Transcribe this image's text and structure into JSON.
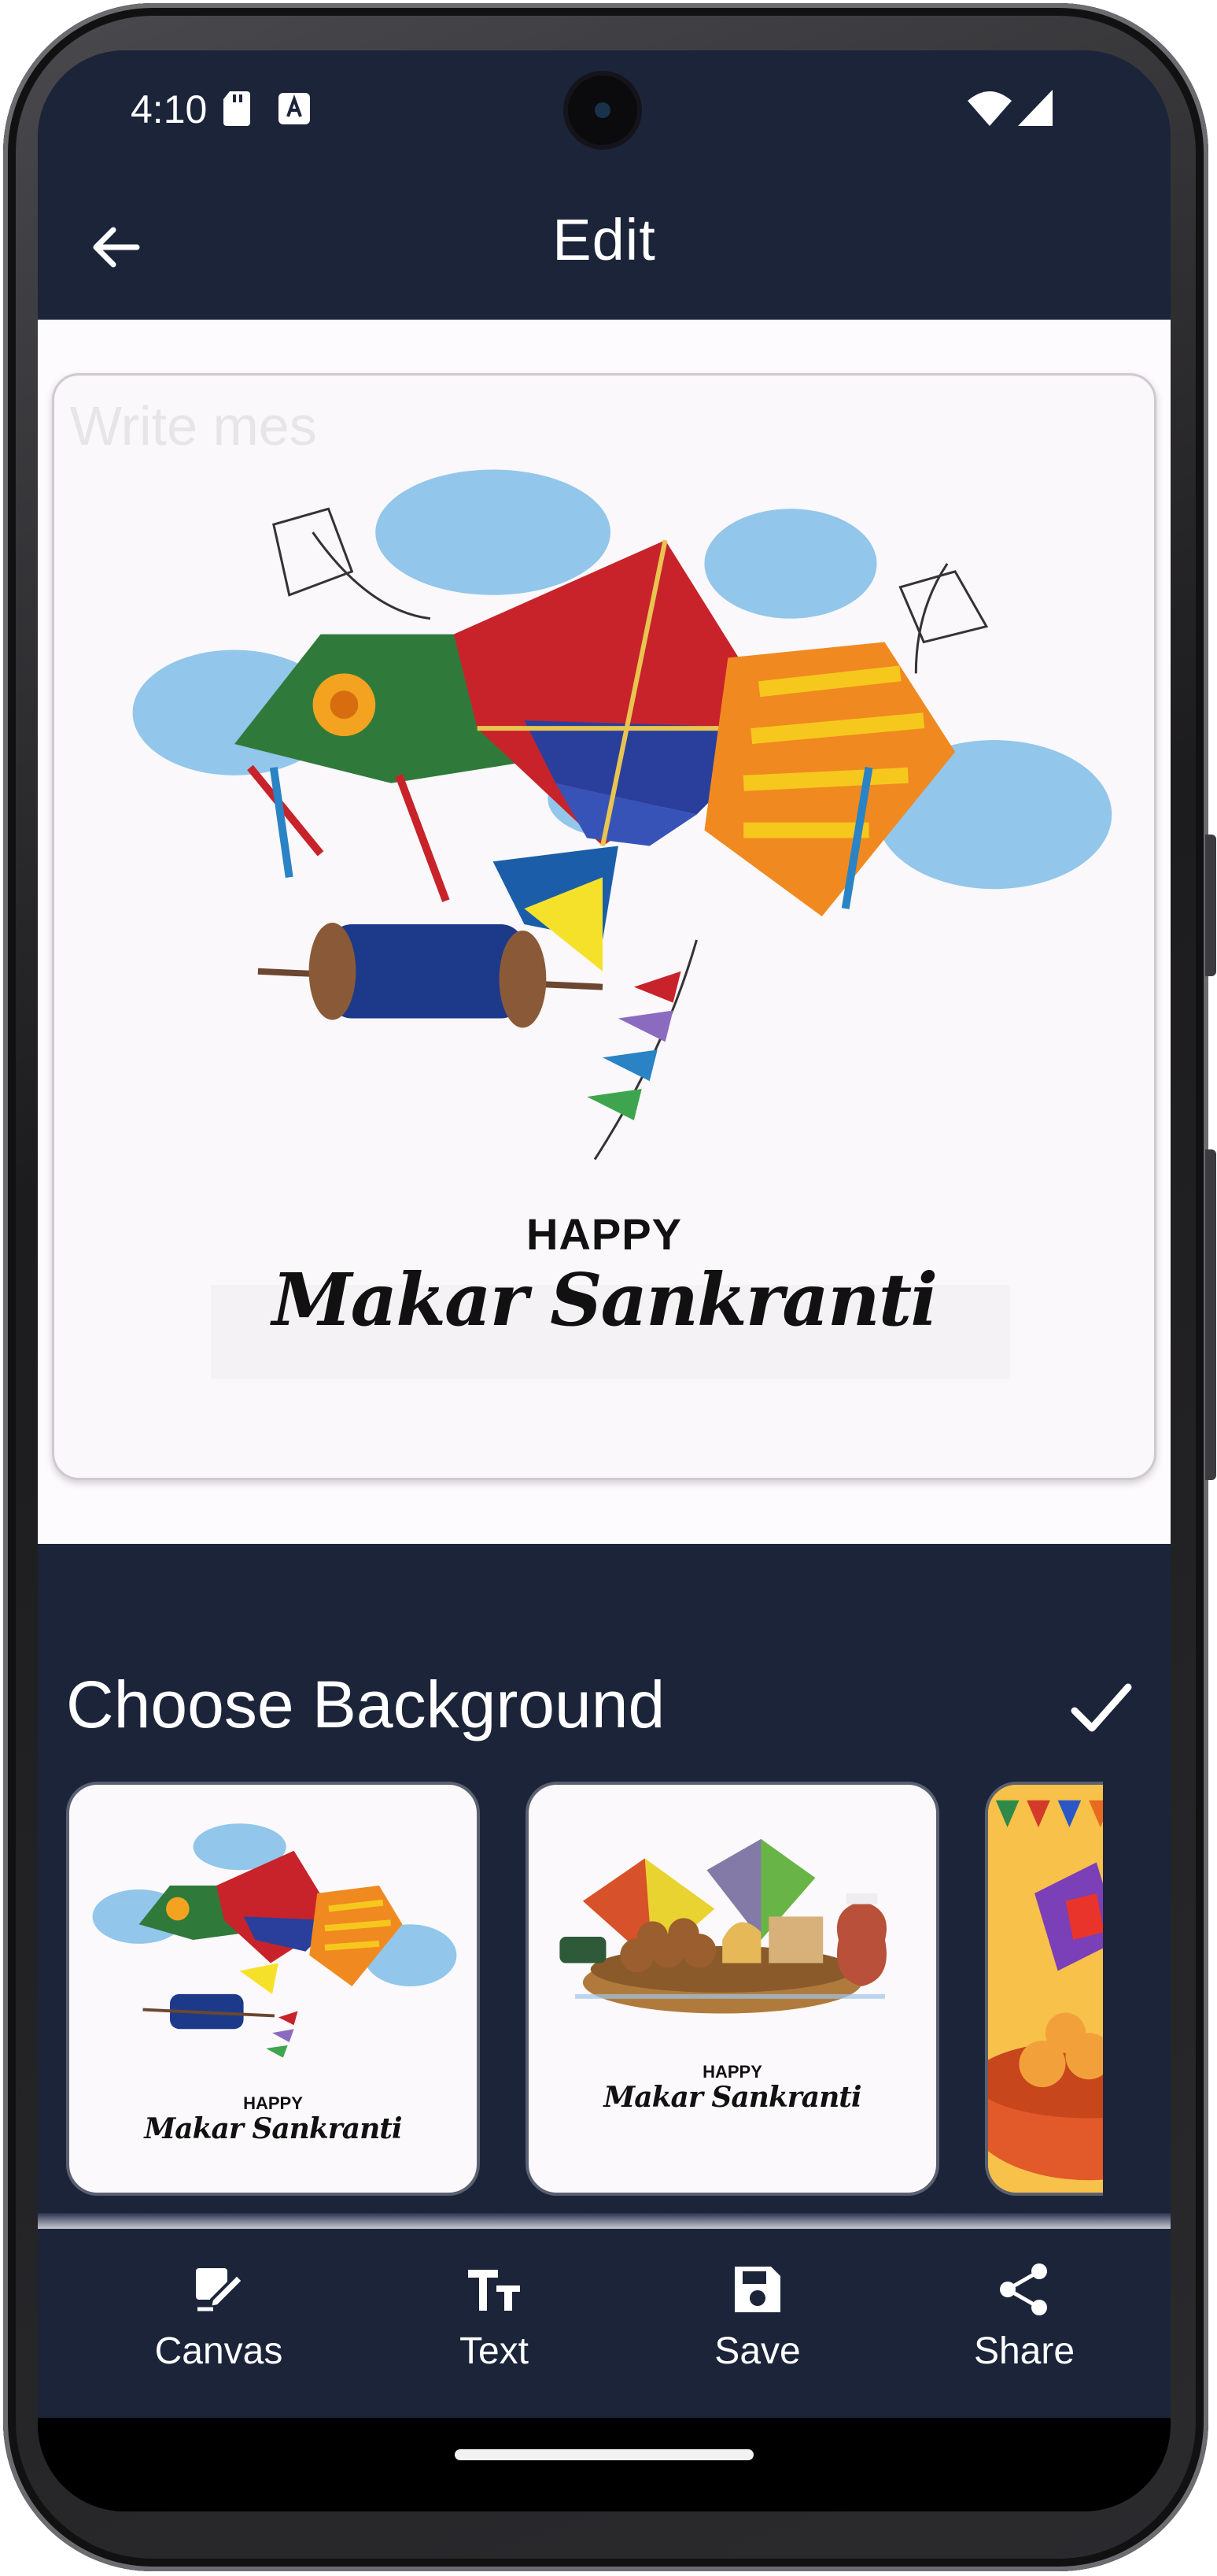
{
  "status_bar": {
    "time": "4:10",
    "icons": [
      "sd-card-icon",
      "keyboard-a-icon",
      "wifi-icon",
      "signal-icon"
    ]
  },
  "app_bar": {
    "title": "Edit",
    "back_icon": "arrow-left-icon"
  },
  "canvas": {
    "placeholder_text": "Write mes",
    "greeting_line1": "HAPPY",
    "greeting_line2": "Makar Sankranti"
  },
  "background_picker": {
    "title": "Choose Background",
    "confirm_icon": "check-icon",
    "thumbnails": [
      {
        "happy": "HAPPY",
        "name": "Makar Sankranti"
      },
      {
        "happy": "HAPPY",
        "name": "Makar Sankranti"
      },
      {
        "happy": "",
        "name": ""
      }
    ]
  },
  "bottom_nav": {
    "items": [
      {
        "label": "Canvas",
        "icon": "edit-canvas-icon"
      },
      {
        "label": "Text",
        "icon": "text-size-icon"
      },
      {
        "label": "Save",
        "icon": "save-icon"
      },
      {
        "label": "Share",
        "icon": "share-icon"
      }
    ]
  },
  "colors": {
    "primary_dark": "#1c243a",
    "accent_white": "#ffffff",
    "canvas_bg": "#fdfbfd"
  }
}
